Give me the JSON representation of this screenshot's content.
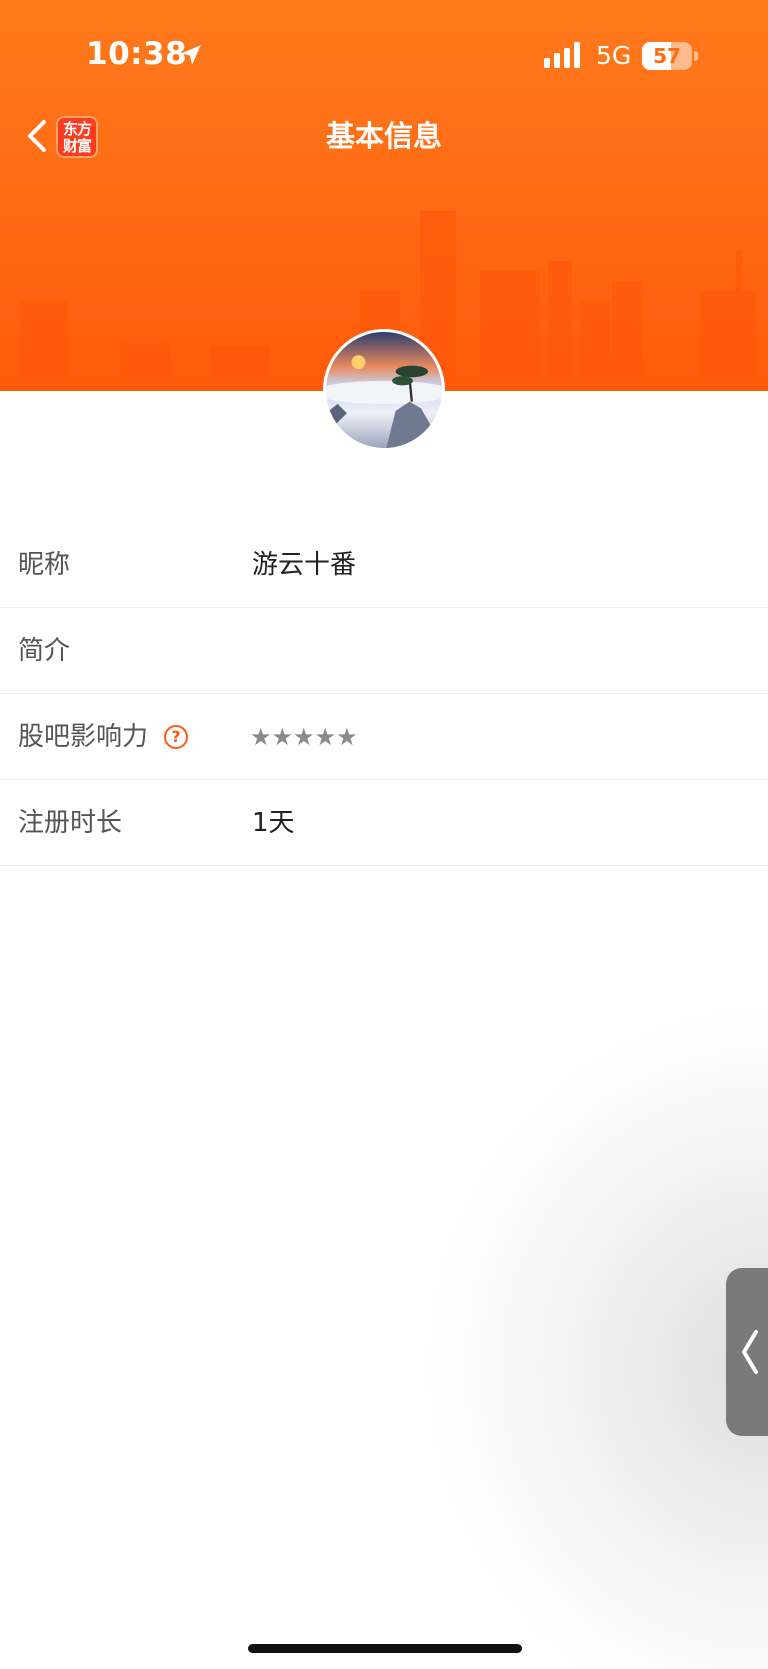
{
  "status_bar": {
    "time": "10:38",
    "network": "5G",
    "battery": "57",
    "battery_level_percent": 57,
    "icons": [
      "location-arrow-icon",
      "cellular-signal-icon",
      "battery-icon"
    ]
  },
  "header": {
    "title": "基本信息",
    "brand_line1": "东方",
    "brand_line2": "财富",
    "accent_color": "#ff6a12"
  },
  "profile": {
    "avatar_icon": "landscape-avatar-icon"
  },
  "info": {
    "rows": [
      {
        "label": "昵称",
        "value": "游云十番"
      },
      {
        "label": "简介",
        "value": ""
      },
      {
        "label": "股吧影响力",
        "value": "★★★★★",
        "help": "?"
      },
      {
        "label": "注册时长",
        "value": "1天"
      }
    ]
  },
  "side_handle": {
    "icon": "chevron-left-icon"
  }
}
